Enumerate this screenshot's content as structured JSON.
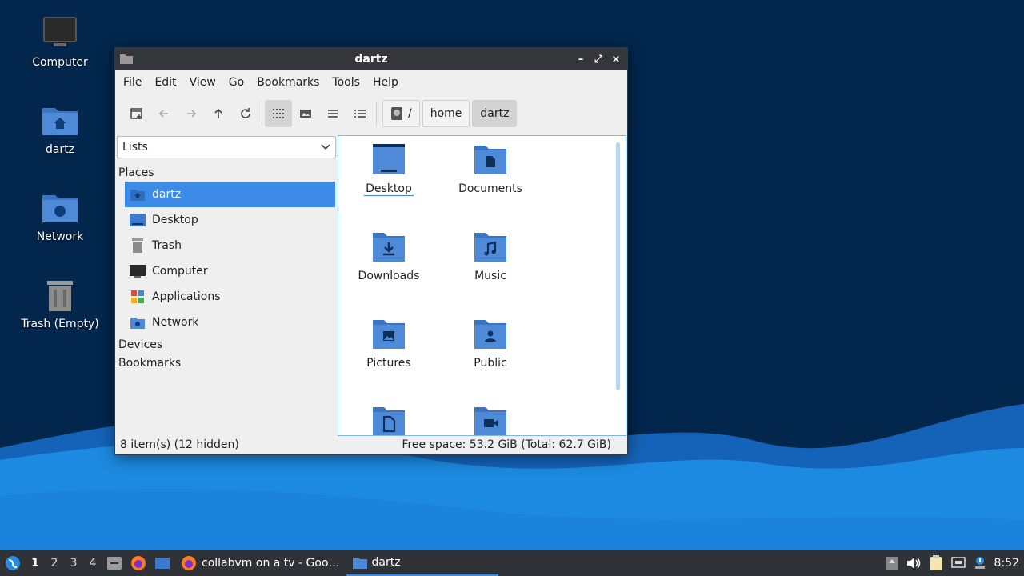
{
  "desktop": {
    "icons": [
      {
        "label": "Computer",
        "icon": "computer-icon"
      },
      {
        "label": "dartz",
        "icon": "home-folder-icon"
      },
      {
        "label": "Network",
        "icon": "network-folder-icon"
      },
      {
        "label": "Trash (Empty)",
        "icon": "trash-icon"
      }
    ]
  },
  "window": {
    "title": "dartz",
    "controls": {
      "minimize": "–",
      "maximize": "⤢",
      "close": "×"
    }
  },
  "menubar": [
    "File",
    "Edit",
    "View",
    "Go",
    "Bookmarks",
    "Tools",
    "Help"
  ],
  "toolbar": {
    "path": {
      "root": "/",
      "home": "home",
      "current": "dartz"
    }
  },
  "sidepane": {
    "mode": "Lists",
    "places_header": "Places",
    "places": [
      {
        "label": "dartz",
        "icon": "home-folder-icon",
        "selected": true
      },
      {
        "label": "Desktop",
        "icon": "desktop-icon"
      },
      {
        "label": "Trash",
        "icon": "trash-icon"
      },
      {
        "label": "Computer",
        "icon": "computer-icon"
      },
      {
        "label": "Applications",
        "icon": "applications-icon"
      },
      {
        "label": "Network",
        "icon": "network-icon"
      }
    ],
    "devices_header": "Devices",
    "bookmarks_header": "Bookmarks"
  },
  "files": [
    {
      "label": "Desktop",
      "icon": "desktop-folder-icon"
    },
    {
      "label": "Documents",
      "icon": "documents-folder-icon"
    },
    {
      "label": "Downloads",
      "icon": "downloads-folder-icon"
    },
    {
      "label": "Music",
      "icon": "music-folder-icon"
    },
    {
      "label": "Pictures",
      "icon": "pictures-folder-icon"
    },
    {
      "label": "Public",
      "icon": "public-folder-icon"
    },
    {
      "label": "",
      "icon": "templates-folder-icon"
    },
    {
      "label": "",
      "icon": "videos-folder-icon"
    }
  ],
  "statusbar": {
    "items": "8 item(s) (12 hidden)",
    "free_space": "Free space: 53.2 GiB (Total: 62.7 GiB)"
  },
  "taskbar": {
    "workspaces": [
      "1",
      "2",
      "3",
      "4"
    ],
    "tasks": [
      {
        "label": "collabvm on a tv - Goo…",
        "icon": "firefox-icon"
      },
      {
        "label": "dartz",
        "icon": "folder-icon",
        "active": true
      }
    ],
    "clock": "8:52"
  },
  "colors": {
    "accent": "#3c8ce7",
    "folder": "#4f8ad8",
    "taskbar": "#2f3237"
  }
}
